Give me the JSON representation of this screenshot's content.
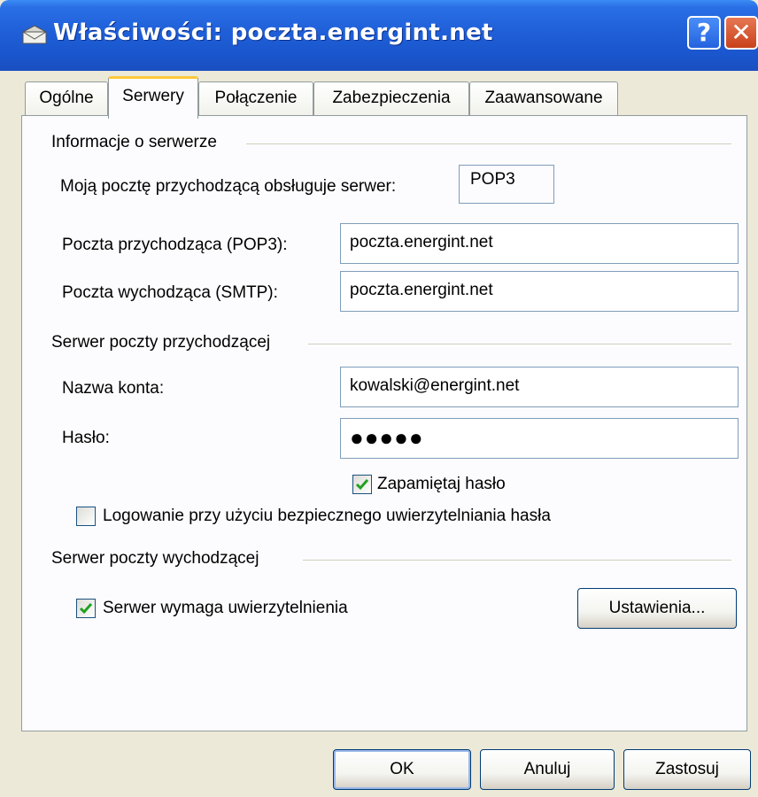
{
  "window": {
    "title": "Właściwości: poczta.energint.net",
    "help_glyph": "?",
    "close_glyph": "✕"
  },
  "tabs": [
    {
      "label": "Ogólne"
    },
    {
      "label": "Serwery"
    },
    {
      "label": "Połączenie"
    },
    {
      "label": "Zabezpieczenia"
    },
    {
      "label": "Zaawansowane"
    }
  ],
  "server_info": {
    "header": "Informacje o serwerze",
    "incoming_type_label": "Moją pocztę przychodzącą obsługuje serwer:",
    "incoming_type_value": "POP3",
    "incoming_label": "Poczta przychodząca (POP3):",
    "incoming_value": "poczta.energint.net",
    "outgoing_label": "Poczta wychodząca (SMTP):",
    "outgoing_value": "poczta.energint.net"
  },
  "incoming_server": {
    "header": "Serwer poczty przychodzącej",
    "account_label": "Nazwa konta:",
    "account_value": "kowalski@energint.net",
    "password_label": "Hasło:",
    "password_value": "●●●●●",
    "remember_label": "Zapamiętaj hasło",
    "remember_checked": true,
    "spa_label": "Logowanie przy użyciu bezpiecznego uwierzytelniania hasła",
    "spa_checked": false
  },
  "outgoing_server": {
    "header": "Serwer poczty wychodzącej",
    "auth_label": "Serwer wymaga uwierzytelnienia",
    "auth_checked": true,
    "settings_button": "Ustawienia..."
  },
  "buttons": {
    "ok": "OK",
    "cancel": "Anuluj",
    "apply": "Zastosuj"
  },
  "colors": {
    "titlebar": "#1F5FD8",
    "dialog_bg": "#ECE9D8",
    "panel_bg": "#FCFCFE",
    "check_green": "#21A121"
  }
}
